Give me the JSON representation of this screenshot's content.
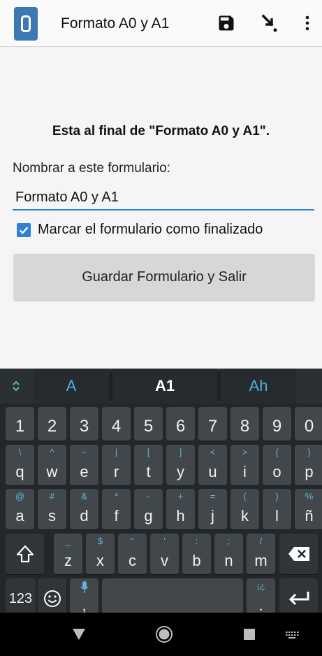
{
  "appbar": {
    "title": "Formato A0 y A1",
    "icons": [
      "app-icon",
      "save-icon",
      "download-arrow-icon",
      "more-vertical-icon"
    ]
  },
  "form": {
    "end_message": "Esta al final de \"Formato A0 y A1\".",
    "name_label": "Nombrar a este formulario:",
    "name_value": "Formato A0 y A1",
    "checkbox_label": "Marcar el formulario como finalizado",
    "checkbox_checked": true,
    "save_button": "Guardar Formulario y Salir"
  },
  "keyboard": {
    "suggestions": [
      "A",
      "A1",
      "Ah"
    ],
    "number_row": [
      "1",
      "2",
      "3",
      "4",
      "5",
      "6",
      "7",
      "8",
      "9",
      "0"
    ],
    "row1": [
      {
        "main": "q",
        "sub": "\\"
      },
      {
        "main": "w",
        "sub": "^"
      },
      {
        "main": "e",
        "sub": "~"
      },
      {
        "main": "r",
        "sub": "|"
      },
      {
        "main": "t",
        "sub": "["
      },
      {
        "main": "y",
        "sub": "]"
      },
      {
        "main": "u",
        "sub": "<"
      },
      {
        "main": "i",
        "sub": ">"
      },
      {
        "main": "o",
        "sub": "{"
      },
      {
        "main": "p",
        "sub": "}"
      }
    ],
    "row2": [
      {
        "main": "a",
        "sub": "@"
      },
      {
        "main": "s",
        "sub": "#"
      },
      {
        "main": "d",
        "sub": "&"
      },
      {
        "main": "f",
        "sub": "*"
      },
      {
        "main": "g",
        "sub": "-"
      },
      {
        "main": "h",
        "sub": "+"
      },
      {
        "main": "j",
        "sub": "="
      },
      {
        "main": "k",
        "sub": "("
      },
      {
        "main": "l",
        "sub": ")"
      },
      {
        "main": "ñ",
        "sub": "%"
      }
    ],
    "row3": [
      {
        "main": "z",
        "sub": "_"
      },
      {
        "main": "x",
        "sub": "$"
      },
      {
        "main": "c",
        "sub": "\""
      },
      {
        "main": "v",
        "sub": "'"
      },
      {
        "main": "b",
        "sub": ":"
      },
      {
        "main": "n",
        "sub": ";"
      },
      {
        "main": "m",
        "sub": "/"
      }
    ],
    "symbols_key": "123",
    "comma": ",",
    "period": ".",
    "period_sub": "¡¿"
  },
  "colors": {
    "accent": "#2f7ed8",
    "app_icon": "#3c78b4",
    "keyboard_bg": "#21272b",
    "key_bg": "#41474b",
    "key_sub": "#5fb7d6"
  }
}
